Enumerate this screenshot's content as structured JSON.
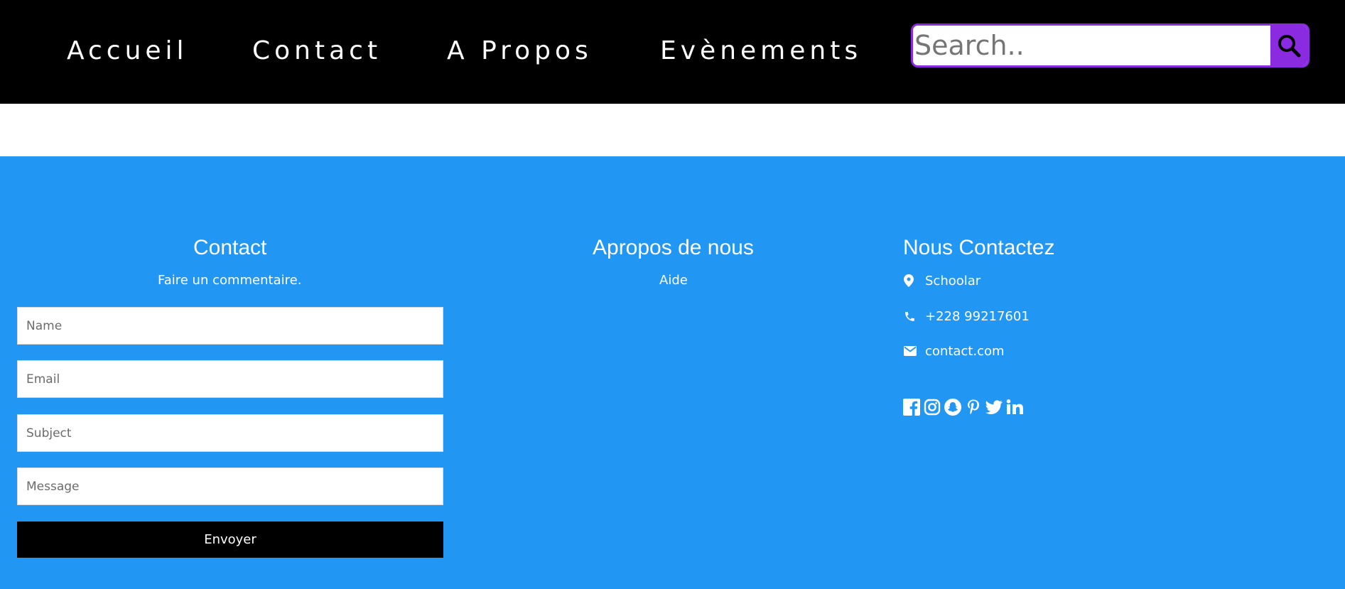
{
  "nav": {
    "items": [
      {
        "label": "Accueil"
      },
      {
        "label": "Contact"
      },
      {
        "label": "A Propos"
      },
      {
        "label": "Evènements"
      }
    ],
    "search": {
      "placeholder": "Search..",
      "value": ""
    }
  },
  "footer": {
    "contact": {
      "title": "Contact",
      "subtitle": "Faire un commentaire.",
      "fields": {
        "name": "Name",
        "email": "Email",
        "subject": "Subject",
        "message": "Message"
      },
      "submit_label": "Envoyer"
    },
    "about": {
      "title": "Apropos de nous",
      "link": "Aide"
    },
    "reach": {
      "title": "Nous Contactez",
      "address": "Schoolar",
      "phone": "+228 99217601",
      "email": "contact.com",
      "socials": [
        "facebook-icon",
        "instagram-icon",
        "snapchat-icon",
        "pinterest-icon",
        "twitter-icon",
        "linkedin-icon"
      ]
    }
  },
  "colors": {
    "nav_bg": "#000000",
    "search_accent": "#8a2be2",
    "footer_bg": "#2196f3",
    "button_bg": "#000000"
  }
}
